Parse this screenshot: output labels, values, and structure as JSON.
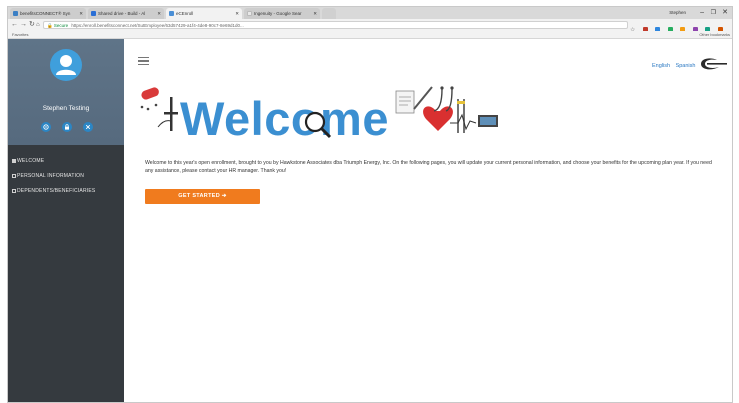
{
  "browser": {
    "tabs": [
      {
        "label": "benefitsCONNECT® Syn",
        "color": "#3b7fc4"
      },
      {
        "label": "Shared drive - Build - Al",
        "color": "#2a6fd6"
      },
      {
        "label": "eCEnroll",
        "color": "#4a8fd6"
      },
      {
        "label": "Ingenuity - Google Sear",
        "color": "#e8e8e8"
      }
    ],
    "user": "Stephen",
    "secure_label": "Secure",
    "url": "https://enroll.benefitsconnect.net/SutEmployee/63d57429-a1f4-4de8-90c7-8e69d1d0...",
    "bookmarks_left": "Favorites",
    "bookmarks_right": "Other bookmarks",
    "colors": {
      "ext": [
        "#c0392b",
        "#2e86de",
        "#27ae60",
        "#f39c12",
        "#8e44ad",
        "#16a085",
        "#d35400",
        "#7f8c8d"
      ]
    }
  },
  "sidebar": {
    "username": "Stephen Testing",
    "menu": [
      {
        "label": "WELCOME",
        "active": true
      },
      {
        "label": "PERSONAL INFORMATION",
        "active": false
      },
      {
        "label": "DEPENDENTS/BENEFICIARIES",
        "active": false
      }
    ]
  },
  "header": {
    "languages": [
      "English",
      "Spanish"
    ]
  },
  "banner": {
    "title": "Welcome"
  },
  "content": {
    "intro": "Welcome to this year's open enrollment, brought to you by Hawkstone Associates dba Triumph Energy, Inc. On the following pages, you will update your current personal information, and choose your benefits for the upcoming plan year. If you need any assistance, please contact your HR manager. Thank you!",
    "cta": "GET STARTED ➔"
  },
  "theme": {
    "sidebar_bg": "#353a3f",
    "profile_bg": "#5f7488",
    "accent": "#3b8fd1",
    "cta": "#f07b1e",
    "link": "#2a78c2"
  }
}
